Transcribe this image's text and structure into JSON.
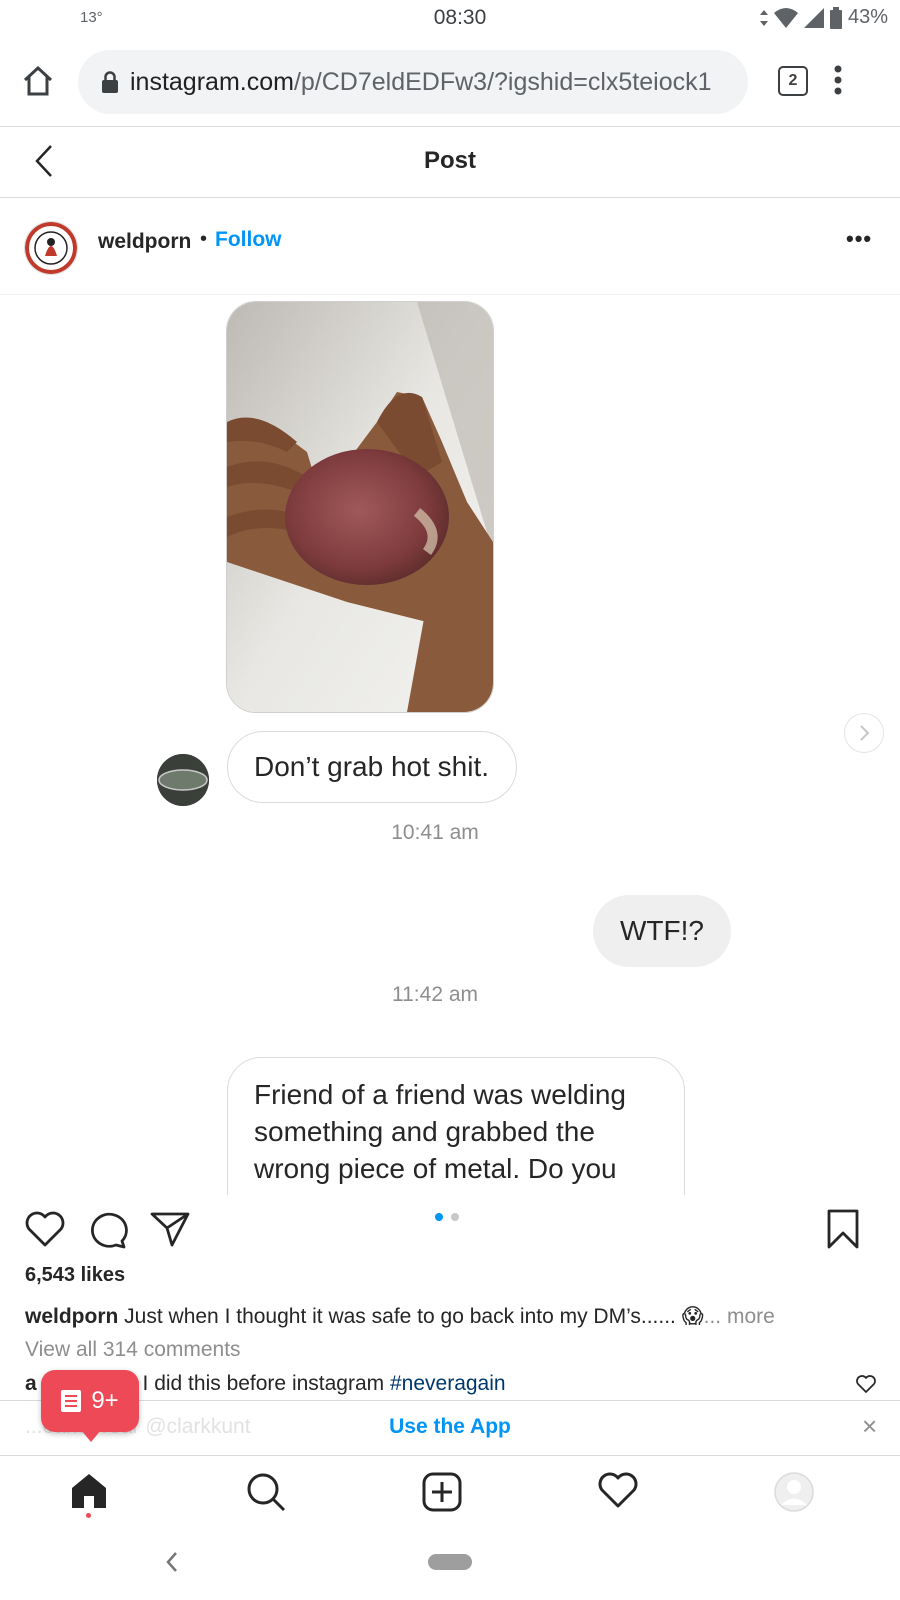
{
  "status_bar": {
    "time": "08:30",
    "temperature": "13°",
    "battery": "43%"
  },
  "browser": {
    "url_host": "instagram.com",
    "url_path": "/p/CD7eldEDFw3/?igshid=clx5teiock1",
    "tab_count": "2"
  },
  "post_header": {
    "title": "Post"
  },
  "post_user": {
    "username": "weldporn",
    "separator": "•",
    "follow_label": "Follow"
  },
  "media": {
    "messages": [
      {
        "text": "Don’t grab hot shit."
      },
      {
        "time": "10:41 am"
      },
      {
        "text": "WTF!?"
      },
      {
        "time": "11:42 am"
      },
      {
        "text_lines": [
          "Friend of a friend was welding",
          "something and grabbed the",
          "wrong piece of metal. Do you"
        ]
      }
    ],
    "carousel_pages": 2,
    "current_page": 1
  },
  "post": {
    "likes": "6,543 likes",
    "caption_user": "weldporn",
    "caption_text": " Just when I thought it was safe to go back into my DM’s...... ",
    "caption_emoji": "😱",
    "caption_more": "... more",
    "view_all": "View all 314 comments",
    "comment_user_fragment": "a",
    "comment_text": " I did this before instagram ",
    "comment_tag": "#neveragain"
  },
  "banner": {
    "use_app_label": "Use the App",
    "ghost_text": "...earmeroar @clarkkunt",
    "close_icon": "×"
  },
  "notification_badge": {
    "count": "9+"
  },
  "colors": {
    "accent": "#0095f6",
    "badge": "#ed4956",
    "text": "#262626",
    "muted": "#8e8e8e"
  }
}
